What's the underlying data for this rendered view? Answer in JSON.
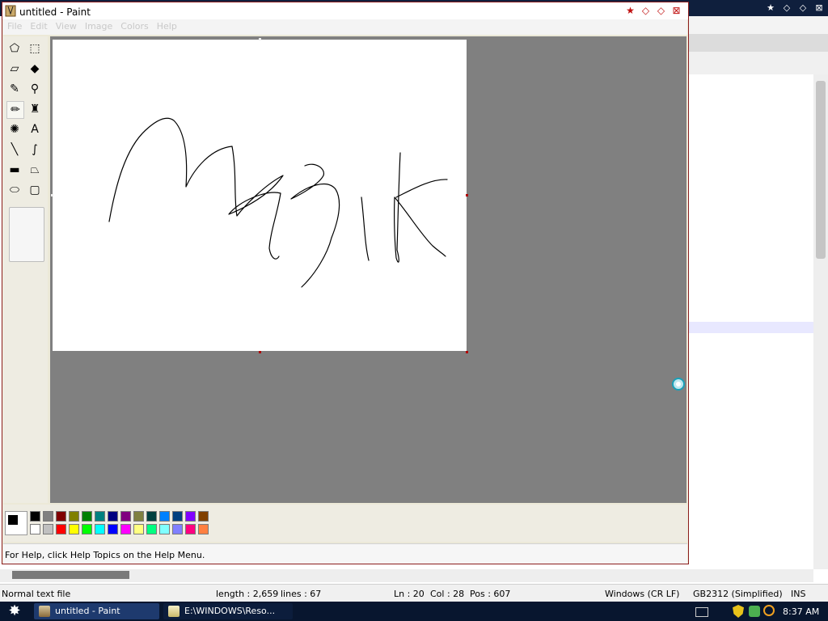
{
  "background_window": {
    "controls": [
      "close-icon",
      "restore-icon",
      "minimize-icon"
    ]
  },
  "statusbar2": {
    "file_type": "Normal text file",
    "length": "length : 2,659",
    "lines": "lines : 67",
    "ln": "Ln : 20",
    "col": "Col : 28",
    "pos": "Pos : 607",
    "eol": "Windows (CR LF)",
    "encoding": "GB2312 (Simplified)",
    "mode": "INS"
  },
  "taskbar": {
    "start_icon": "star-icon",
    "tasks": [
      {
        "label": "untitled - Paint",
        "icon": "paint-icon"
      },
      {
        "label": "E:\\WINDOWS\\Reso...",
        "icon": "notepad-icon"
      }
    ],
    "clock": "8:37 AM"
  },
  "paint": {
    "title": "untitled - Paint",
    "menu": [
      "File",
      "Edit",
      "View",
      "Image",
      "Colors",
      "Help"
    ],
    "tools": [
      {
        "name": "free-form-select-icon",
        "glyph": "⬠"
      },
      {
        "name": "select-icon",
        "glyph": "⬚"
      },
      {
        "name": "eraser-icon",
        "glyph": "▱"
      },
      {
        "name": "fill-icon",
        "glyph": "◆"
      },
      {
        "name": "pick-color-icon",
        "glyph": "✎"
      },
      {
        "name": "magnifier-icon",
        "glyph": "⚲"
      },
      {
        "name": "pencil-icon",
        "glyph": "✏"
      },
      {
        "name": "brush-icon",
        "glyph": "♜"
      },
      {
        "name": "airbrush-icon",
        "glyph": "✺"
      },
      {
        "name": "text-icon",
        "glyph": "A"
      },
      {
        "name": "line-icon",
        "glyph": "╲"
      },
      {
        "name": "curve-icon",
        "glyph": "∫"
      },
      {
        "name": "rectangle-icon",
        "glyph": "▬"
      },
      {
        "name": "polygon-icon",
        "glyph": "⏢"
      },
      {
        "name": "ellipse-icon",
        "glyph": "⬭"
      },
      {
        "name": "rounded-rectangle-icon",
        "glyph": "▢"
      }
    ],
    "palette_top": [
      "#000000",
      "#808080",
      "#800000",
      "#808000",
      "#008000",
      "#008080",
      "#000080",
      "#800080",
      "#808040",
      "#004040",
      "#0080ff",
      "#004080",
      "#8000ff",
      "#804000"
    ],
    "palette_bottom": [
      "#ffffff",
      "#c0c0c0",
      "#ff0000",
      "#ffff00",
      "#00ff00",
      "#00ffff",
      "#0000ff",
      "#ff00ff",
      "#ffff80",
      "#00ff80",
      "#80ffff",
      "#8080ff",
      "#ff0080",
      "#ff8040"
    ],
    "foreground_color": "#000000",
    "background_color": "#ffffff",
    "status": "For Help, click Help Topics on the Help Menu.",
    "drawing": "hand-drawn scribble"
  }
}
